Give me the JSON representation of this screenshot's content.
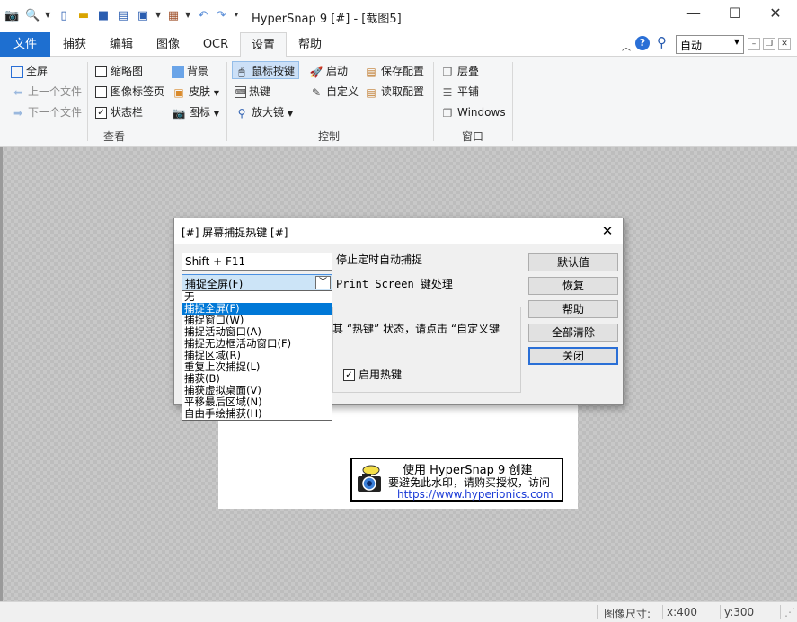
{
  "window": {
    "title": "HyperSnap 9 [#] - [截图5]"
  },
  "tabs": [
    {
      "label": "文件"
    },
    {
      "label": "捕获"
    },
    {
      "label": "编辑"
    },
    {
      "label": "图像"
    },
    {
      "label": "OCR"
    },
    {
      "label": "设置"
    },
    {
      "label": "帮助"
    }
  ],
  "toolbar_right": {
    "help_glyph": "?",
    "zoom_value": "自动"
  },
  "ribbon": {
    "view": {
      "fullscreen": "全屏",
      "prev_file": "上一个文件",
      "next_file": "下一个文件",
      "thumbnails": "缩略图",
      "image_tabs": "图像标签页",
      "statusbar": "状态栏",
      "background": "背景",
      "skin": "皮肤",
      "icons": "图标",
      "group": "查看"
    },
    "control": {
      "mouse_buttons": "鼠标按键",
      "hotkeys": "热键",
      "magnifier": "放大镜",
      "startup": "启动",
      "customize": "自定义",
      "save_config": "保存配置",
      "load_config": "读取配置",
      "group": "控制"
    },
    "window": {
      "cascade": "层叠",
      "tile": "平铺",
      "windows": "Windows",
      "group": "窗口"
    }
  },
  "watermark": {
    "line1": "使用 HyperSnap 9 创建",
    "line2": "要避免此水印，请购买授权，访问",
    "line3": "https://www.hyperionics.com"
  },
  "dialog": {
    "title": "[#] 屏幕捕捉热键 [#]",
    "hotkey_value": "Shift + F11",
    "stop_label": "停止定时自动捕捉",
    "combo_value": "捕捉全屏(F)",
    "printscreen_label": "Print Screen 键处理",
    "note": "其 “热键” 状态，请点击 “自定义键",
    "enable_hotkey": "启用热键",
    "buttons": {
      "defaults": "默认值",
      "restore": "恢复",
      "help": "帮助",
      "clear_all": "全部清除",
      "close": "关闭"
    },
    "options": [
      "无",
      "捕捉全屏(F)",
      "捕捉窗口(W)",
      "捕捉活动窗口(A)",
      "捕捉无边框活动窗口(F)",
      "捕捉区域(R)",
      "重复上次捕捉(L)",
      "捕获(B)",
      "捕获虚拟桌面(V)",
      "平移最后区域(N)",
      "自由手绘捕获(H)"
    ]
  },
  "statusbar": {
    "image_size_label": "图像尺寸:",
    "x": "x:400",
    "y": "y:300"
  },
  "colors": {
    "accent": "#1e6fd0",
    "selection": "#0078d7",
    "link": "#1a3ad6"
  }
}
